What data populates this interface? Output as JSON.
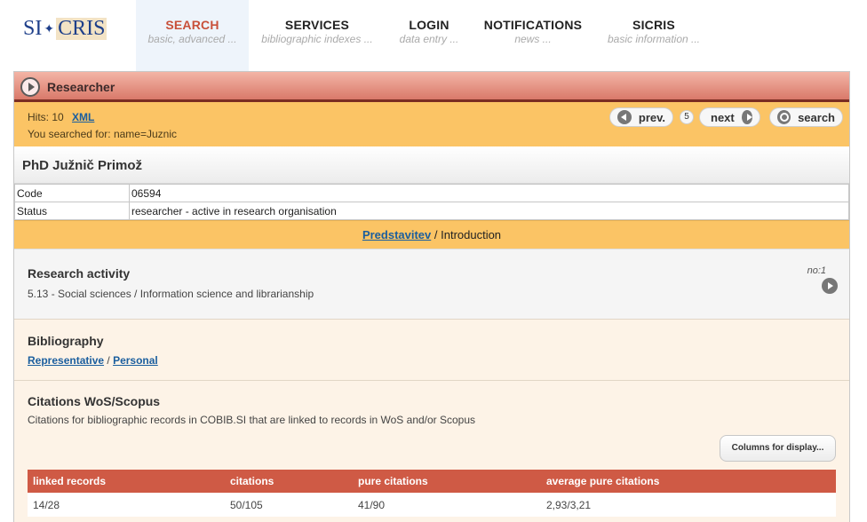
{
  "logo": {
    "left": "SI",
    "right": "CRIS"
  },
  "nav": [
    {
      "title": "SEARCH",
      "sub": "basic, advanced ..."
    },
    {
      "title": "SERVICES",
      "sub": "bibliographic indexes ..."
    },
    {
      "title": "LOGIN",
      "sub": "data entry ..."
    },
    {
      "title": "NOTIFICATIONS",
      "sub": "news ..."
    },
    {
      "title": "SICRIS",
      "sub": "basic information ..."
    }
  ],
  "panel": {
    "title": "Researcher",
    "hits_label": "Hits: 10",
    "xml_link": "XML",
    "searched_for": "You searched for: name=Juznic",
    "prev_label": "prev.",
    "page": "5",
    "next_label": "next",
    "search_label": "search"
  },
  "person": {
    "name": "PhD Južnič Primož",
    "rows": [
      {
        "key": "Code",
        "value": "06594"
      },
      {
        "key": "Status",
        "value": "researcher - active in research organisation"
      }
    ]
  },
  "intro": {
    "link": "Predstavitev",
    "sep": " / ",
    "text": "Introduction"
  },
  "research": {
    "title": "Research activity",
    "text": "5.13 - Social sciences / Information science and librarianship",
    "no": "no:1"
  },
  "bibliography": {
    "title": "Bibliography",
    "link1": "Representative",
    "sep": " / ",
    "link2": "Personal"
  },
  "citations": {
    "title": "Citations WoS/Scopus",
    "desc": "Citations for bibliographic records in COBIB.SI that are linked to records in WoS and/or Scopus",
    "columns_button": "Columns for display...",
    "headers": [
      "linked records",
      "citations",
      "pure citations",
      "average pure citations"
    ],
    "row": [
      "14/28",
      "50/105",
      "41/90",
      "2,93/3,21"
    ]
  }
}
